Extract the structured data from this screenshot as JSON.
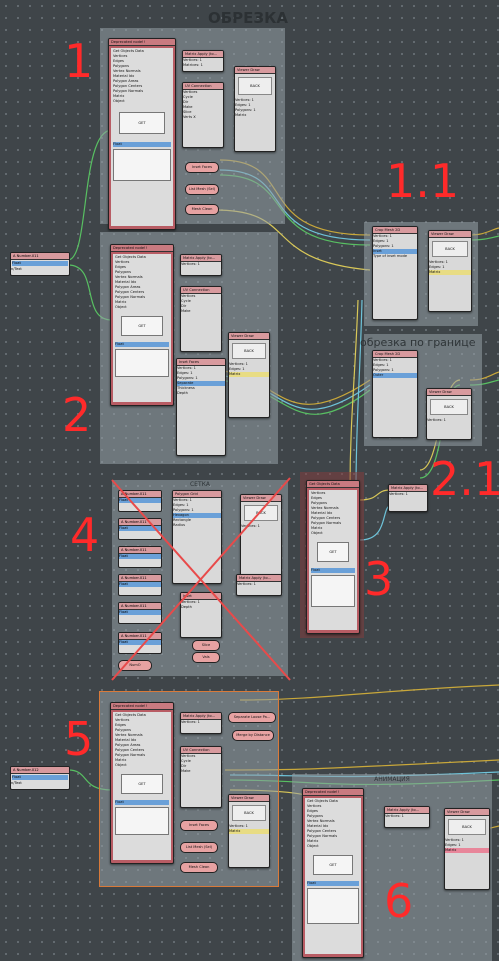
{
  "titles": {
    "main": "ОБРЕЗКА",
    "border_trim": "обрезка по границе",
    "grid": "СЕТКА",
    "wires": "АНИМАЦИЯ"
  },
  "markers": {
    "m1": "1",
    "m11": "1.1",
    "m2": "2",
    "m21": "2.1",
    "m3": "3",
    "m4": "4",
    "m5": "5",
    "m6": "6"
  },
  "labels": {
    "deprecated": "Deprecated node!!",
    "get_objects": "Get Objects Data",
    "matrix_apply": "Matrix Apply (to...",
    "uv_connection": "UV Connection",
    "viewer_draw": "Viewer Draw",
    "inset_faces": "Inset Faces",
    "list_mesh": "List Mesh (Sel)",
    "mesh_clean": "Mesh Clean",
    "number": "A Number.011",
    "number2": "A Number.012",
    "crop_mesh": "Crop Mesh 2D",
    "polygon_grid": "Polygon Grid",
    "get": "GET",
    "vertices": "Vertices",
    "edges": "Edges",
    "polygons": "Polygons",
    "vertex_normals": "Vertex Normals",
    "material_idx": "Material Idx",
    "polygon_areas": "Polygon Areas",
    "polygon_centers": "Polygon Centers",
    "polygon_normals": "Polygon Normals",
    "matrix": "Matrix",
    "object": "Object",
    "float": "Float",
    "value": "n/Text",
    "value_num": "0.00",
    "post": "Post",
    "vals": "Vals",
    "send": "Send",
    "cycle": "Cycle",
    "dir": "Dir",
    "make": "Make",
    "slice": "Slice",
    "verts_x": "Verts X",
    "inset": "Inset",
    "type_mode": "Type of inset mode",
    "outer": "Outer",
    "separate": "Separate",
    "random": "Random",
    "face_mask": "Face mask",
    "thickness": "Thickness",
    "depth": "Depth",
    "hexagon": "Hexagon",
    "rectangle": "Rectangle",
    "radius": "Radius",
    "number_of": "NumO",
    "merge": "Merge by Distance",
    "separate_loose": "Separate Loose Pa...",
    "viewer_label": "N/A",
    "verts_count": "Vertices: 1",
    "edges_count": "Edges: 1",
    "polys_count": "Polygons: 1",
    "matrices": "Matrices: 1",
    "back": "BACK",
    "merge_label": "Merge by Distance"
  }
}
